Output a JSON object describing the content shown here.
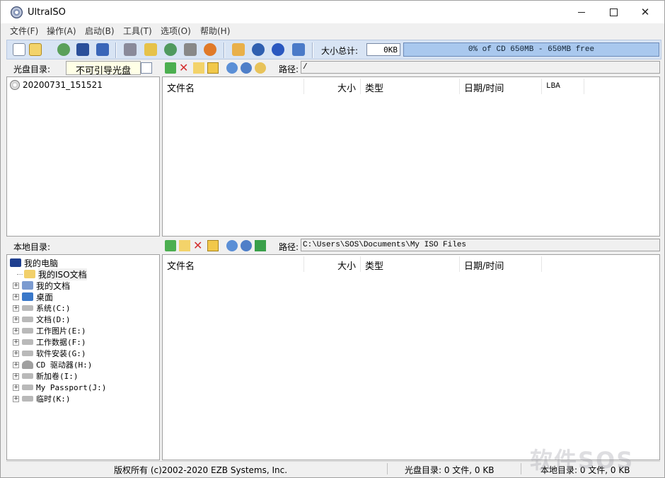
{
  "window": {
    "title": "UltraISO",
    "controls": {
      "minimize": "",
      "maximize": "",
      "close": "✕"
    }
  },
  "menu": [
    "文件(F)",
    "操作(A)",
    "启动(B)",
    "工具(T)",
    "选项(O)",
    "帮助(H)"
  ],
  "toolbar": {
    "icons": [
      "new-icon",
      "open-icon",
      "reload-icon",
      "save-icon",
      "save-as-icon",
      "extract-icon",
      "make-cd-image-icon",
      "make-floppy-image-icon",
      "burn-icon",
      "mount-icon",
      "compress-icon",
      "info-icon",
      "help-icon",
      "exit-icon"
    ],
    "size_label": "大小总计:",
    "size_value": "0KB",
    "capacity_text": "0% of CD 650MB - 650MB free",
    "capacity_percent": 0
  },
  "iso_pane": {
    "label": "光盘目录:",
    "boot_label": "不可引导光盘",
    "path_label": "路径:",
    "path": "/",
    "tree": [
      {
        "label": "20200731_151521",
        "icon": "cd-icon"
      }
    ],
    "columns": [
      "文件名",
      "大小",
      "类型",
      "日期/时间",
      "LBA"
    ]
  },
  "local_pane": {
    "label": "本地目录:",
    "path_label": "路径:",
    "path": "C:\\Users\\SOS\\Documents\\My ISO Files",
    "tree": [
      {
        "label": "我的电脑",
        "icon": "computer-icon",
        "level": 0
      },
      {
        "label": "我的ISO文档",
        "icon": "iso-folder-icon",
        "level": 1
      },
      {
        "label": "我的文档",
        "icon": "documents-icon",
        "level": 1
      },
      {
        "label": "桌面",
        "icon": "desktop-icon",
        "level": 1
      },
      {
        "label": "系统(C:)",
        "icon": "drive-icon",
        "level": 1
      },
      {
        "label": "文档(D:)",
        "icon": "drive-icon",
        "level": 1
      },
      {
        "label": "工作图片(E:)",
        "icon": "drive-icon",
        "level": 1
      },
      {
        "label": "工作数据(F:)",
        "icon": "drive-icon",
        "level": 1
      },
      {
        "label": "软件安装(G:)",
        "icon": "drive-icon",
        "level": 1
      },
      {
        "label": "CD 驱动器(H:)",
        "icon": "cd-drive-icon",
        "level": 1
      },
      {
        "label": "新加卷(I:)",
        "icon": "drive-icon",
        "level": 1
      },
      {
        "label": "My Passport(J:)",
        "icon": "drive-icon",
        "level": 1
      },
      {
        "label": "临时(K:)",
        "icon": "drive-icon",
        "level": 1
      }
    ],
    "columns": [
      "文件名",
      "大小",
      "类型",
      "日期/时间"
    ]
  },
  "status": {
    "copyright": "版权所有 (c)2002-2020 EZB Systems, Inc.",
    "iso_summary": "光盘目录: 0 文件, 0 KB",
    "local_summary": "本地目录: 0 文件, 0 KB"
  },
  "watermark": "软件SOS"
}
